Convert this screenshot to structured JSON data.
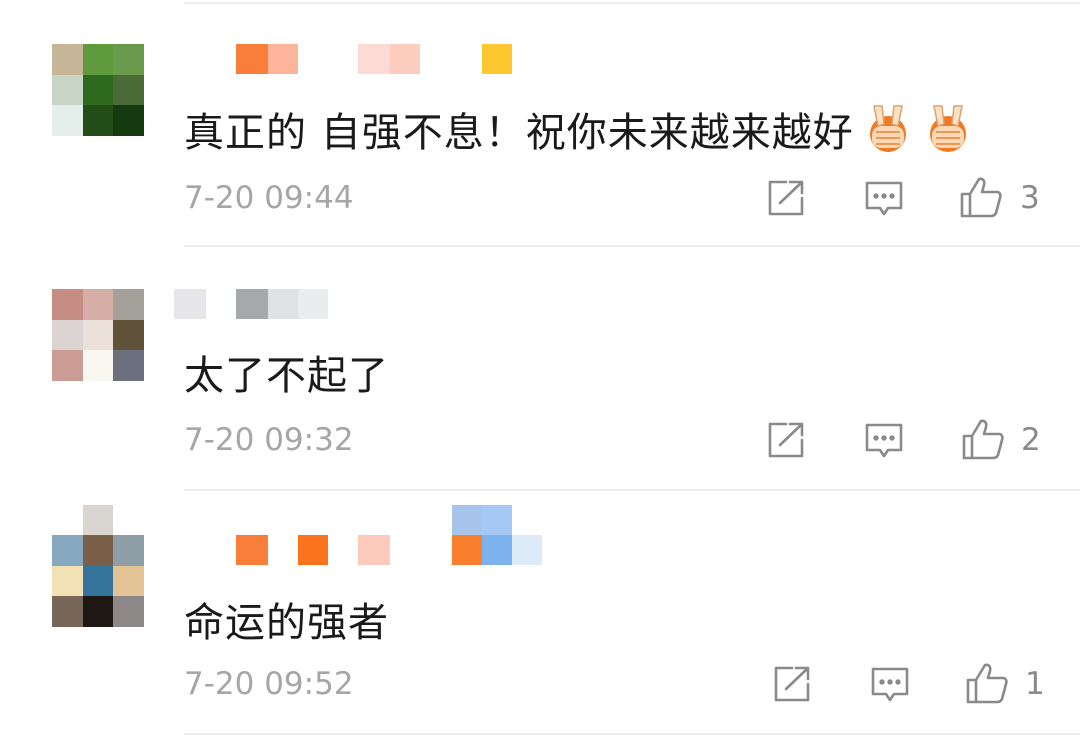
{
  "comments": [
    {
      "text": "真正的 自强不息！祝你未来越来越好",
      "emoji": [
        "hands-emoji",
        "hands-emoji"
      ],
      "time": "7-20 09:44",
      "likes": "3"
    },
    {
      "text": "太了不起了",
      "time": "7-20 09:32",
      "likes": "2"
    },
    {
      "text": "命运的强者",
      "time": "7-20 09:52",
      "likes": "1"
    }
  ],
  "icons": {
    "share": "share-icon",
    "reply": "comment-icon",
    "like": "thumbs-up-icon"
  },
  "colors": {
    "text": "#1a1a1a",
    "meta": "#a6a6a6",
    "icon": "#8a8a8a",
    "divider": "#ededed"
  }
}
